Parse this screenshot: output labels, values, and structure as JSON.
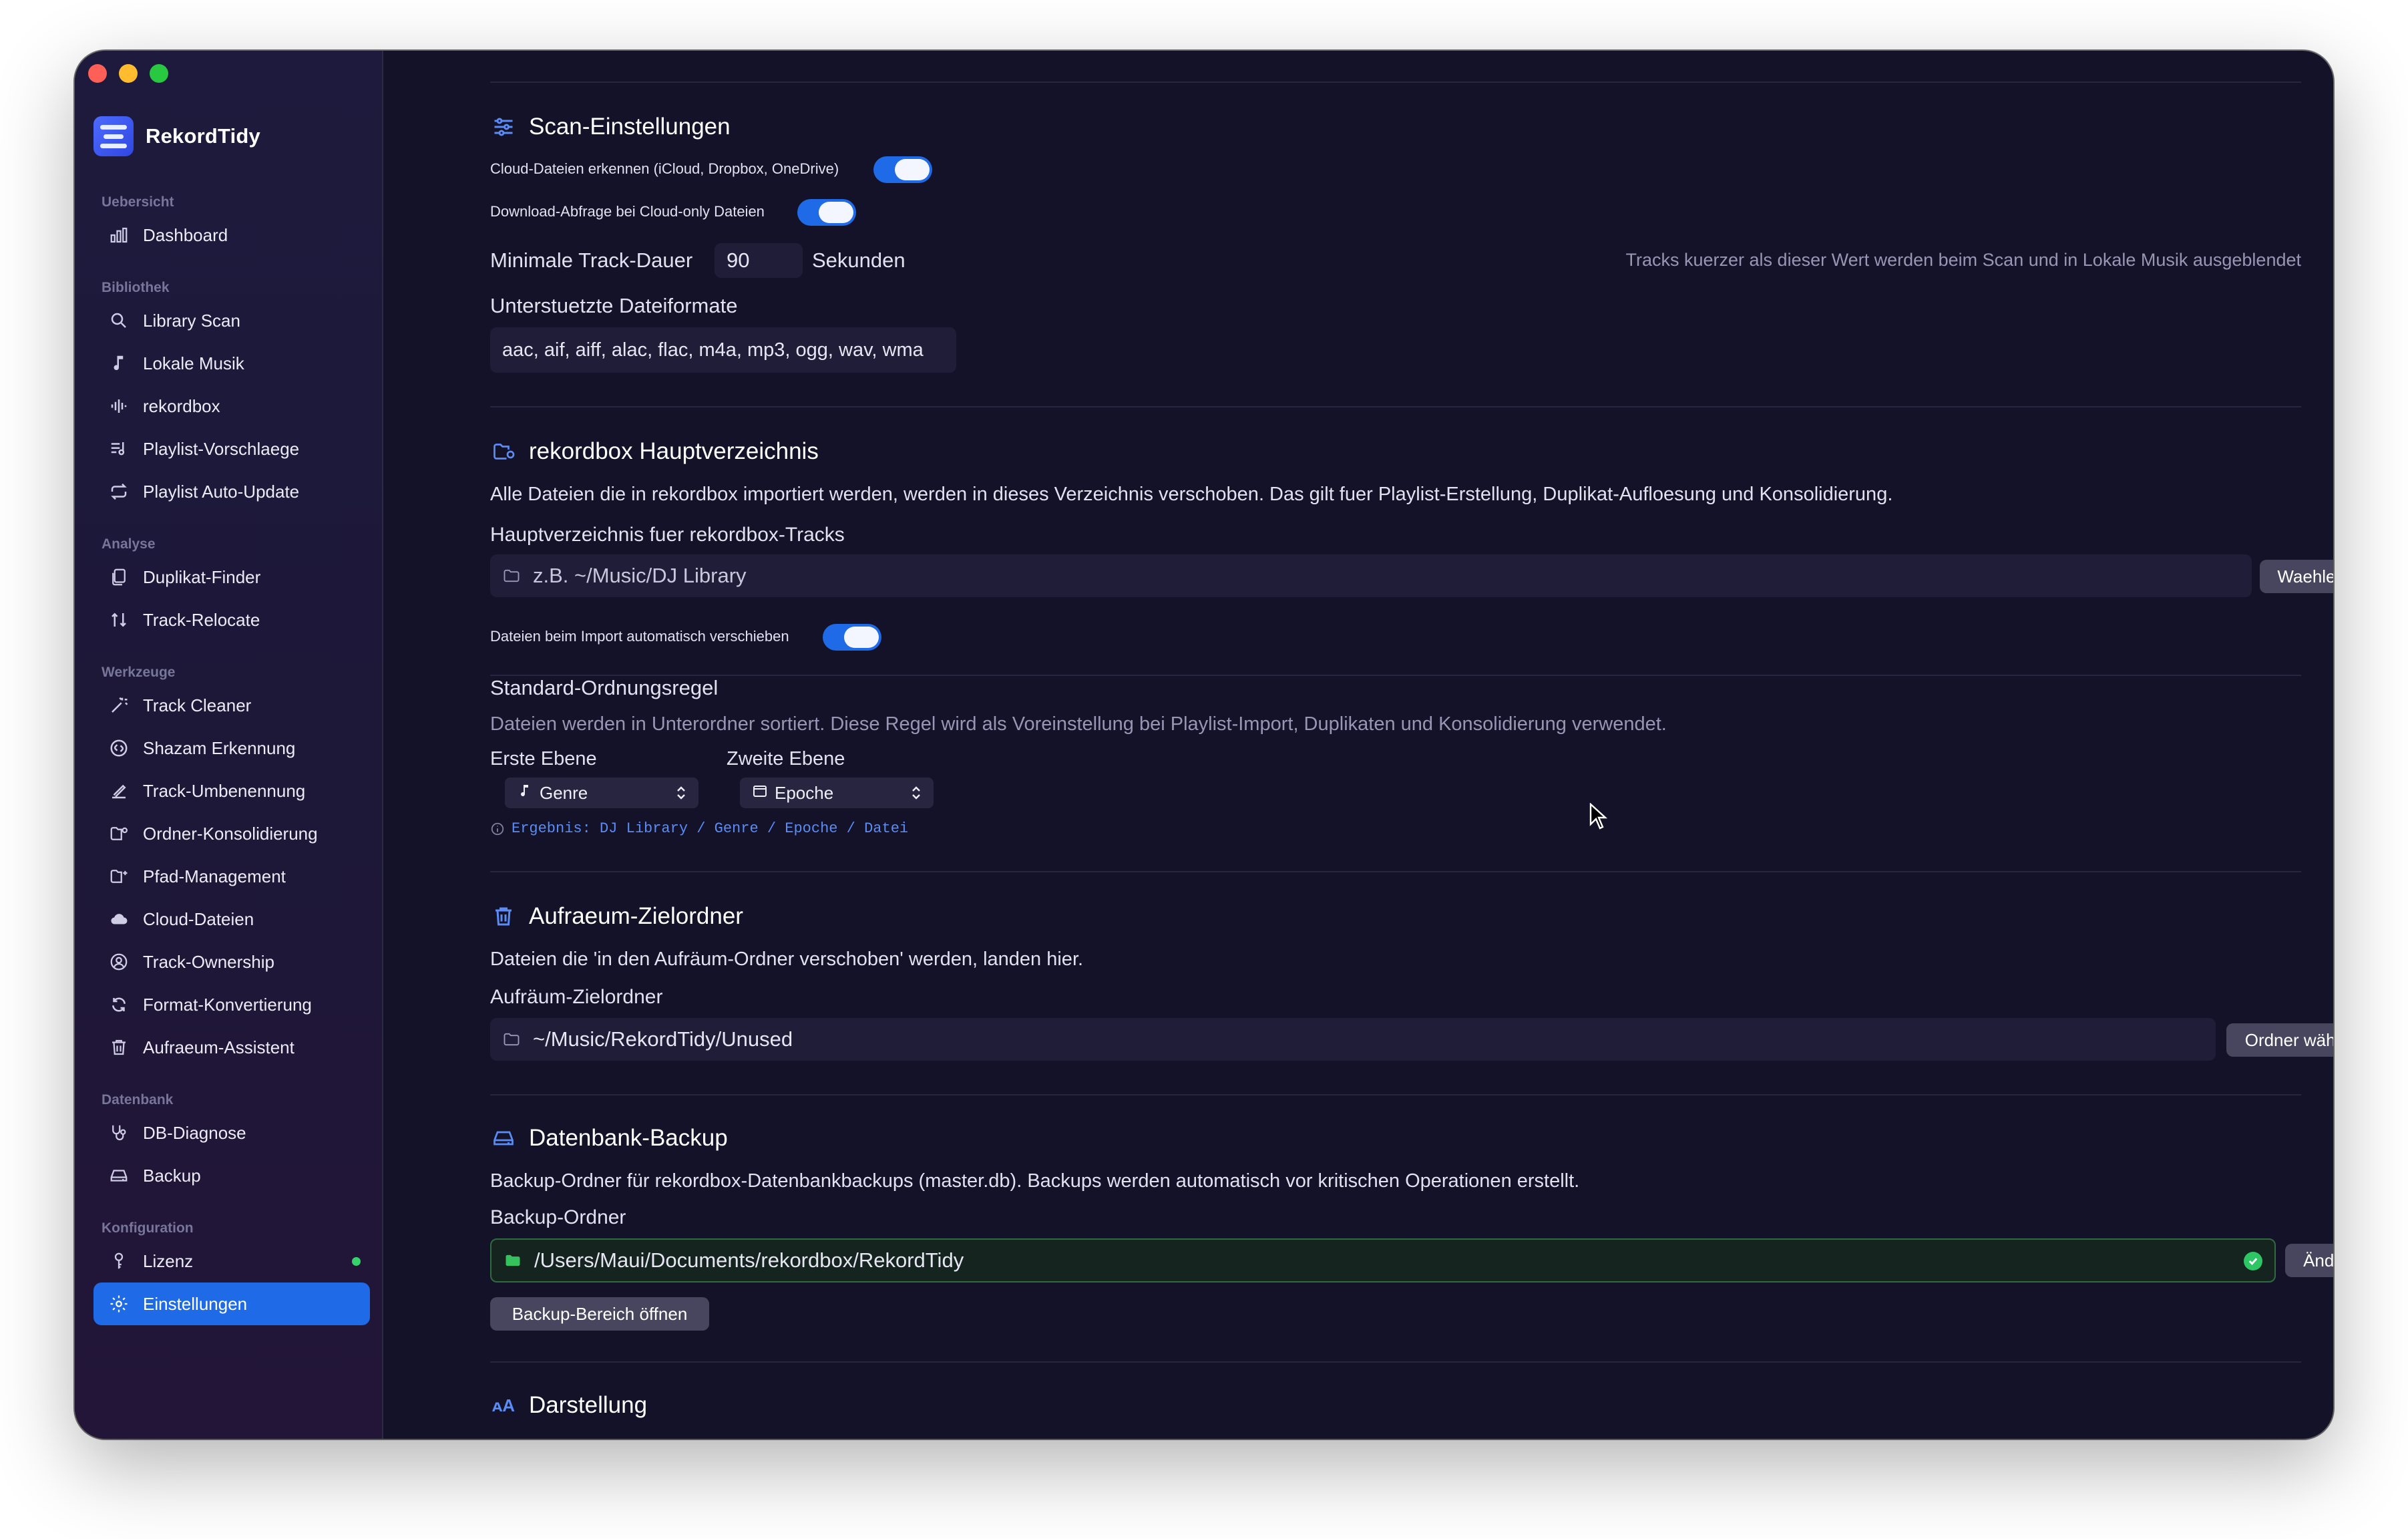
{
  "app": {
    "name": "RekordTidy"
  },
  "sidebar": {
    "sections": [
      {
        "heading": "Uebersicht",
        "items": [
          {
            "label": "Dashboard",
            "icon": "chart-icon"
          }
        ]
      },
      {
        "heading": "Bibliothek",
        "items": [
          {
            "label": "Library Scan",
            "icon": "search-icon"
          },
          {
            "label": "Lokale Musik",
            "icon": "music-note-icon"
          },
          {
            "label": "rekordbox",
            "icon": "waveform-icon"
          },
          {
            "label": "Playlist-Vorschlaege",
            "icon": "playlist-icon"
          },
          {
            "label": "Playlist Auto-Update",
            "icon": "repeat-icon"
          }
        ]
      },
      {
        "heading": "Analyse",
        "items": [
          {
            "label": "Duplikat-Finder",
            "icon": "duplicate-icon"
          },
          {
            "label": "Track-Relocate",
            "icon": "relocate-icon"
          }
        ]
      },
      {
        "heading": "Werkzeuge",
        "items": [
          {
            "label": "Track Cleaner",
            "icon": "wand-icon"
          },
          {
            "label": "Shazam Erkennung",
            "icon": "shazam-icon"
          },
          {
            "label": "Track-Umbenennung",
            "icon": "rename-icon"
          },
          {
            "label": "Ordner-Konsolidierung",
            "icon": "folder-merge-icon"
          },
          {
            "label": "Pfad-Management",
            "icon": "folder-path-icon"
          },
          {
            "label": "Cloud-Dateien",
            "icon": "cloud-icon"
          },
          {
            "label": "Track-Ownership",
            "icon": "ownership-icon"
          },
          {
            "label": "Format-Konvertierung",
            "icon": "convert-icon"
          },
          {
            "label": "Aufraeum-Assistent",
            "icon": "trash-icon"
          }
        ]
      },
      {
        "heading": "Datenbank",
        "items": [
          {
            "label": "DB-Diagnose",
            "icon": "stethoscope-icon"
          },
          {
            "label": "Backup",
            "icon": "drive-icon"
          }
        ]
      },
      {
        "heading": "Konfiguration",
        "items": [
          {
            "label": "Lizenz",
            "icon": "key-icon",
            "status": "active"
          },
          {
            "label": "Einstellungen",
            "icon": "gear-icon",
            "active": true
          }
        ]
      }
    ]
  },
  "scan": {
    "title": "Scan-Einstellungen",
    "cloud_detect_label": "Cloud-Dateien erkennen (iCloud, Dropbox, OneDrive)",
    "cloud_detect_on": true,
    "download_prompt_label": "Download-Abfrage bei Cloud-only Dateien",
    "download_prompt_on": true,
    "min_duration_label": "Minimale Track-Dauer",
    "min_duration_value": "90",
    "min_duration_unit": "Sekunden",
    "min_duration_hint": "Tracks kuerzer als dieser Wert werden beim Scan und in Lokale Musik ausgeblendet",
    "formats_label": "Unterstuetzte Dateiformate",
    "formats_value": "aac, aif, aiff, alac, flac, m4a, mp3, ogg, wav, wma"
  },
  "root": {
    "title": "rekordbox Hauptverzeichnis",
    "description": "Alle Dateien die in rekordbox importiert werden, werden in dieses Verzeichnis verschoben. Das gilt fuer Playlist-Erstellung, Duplikat-Aufloesung und Konsolidierung.",
    "path_label": "Hauptverzeichnis fuer rekordbox-Tracks",
    "path_placeholder": "z.B. ~/Music/DJ Library",
    "choose_button": "Waehlen...",
    "auto_move_label": "Dateien beim Import automatisch verschieben",
    "auto_move_on": true,
    "rule_title": "Standard-Ordnungsregel",
    "rule_description": "Dateien werden in Unterordner sortiert. Diese Regel wird als Voreinstellung bei Playlist-Import, Duplikaten und Konsolidierung verwendet.",
    "first_level_label": "Erste Ebene",
    "first_level_value": "Genre",
    "second_level_label": "Zweite Ebene",
    "second_level_value": "Epoche",
    "result_text": "Ergebnis: DJ Library / Genre / Epoche / Datei"
  },
  "cleanup": {
    "title": "Aufraeum-Zielordner",
    "description": "Dateien die 'in den Aufräum-Ordner verschoben' werden, landen hier.",
    "path_label": "Aufräum-Zielordner",
    "path_value": "~/Music/RekordTidy/Unused",
    "choose_button": "Ordner wählen"
  },
  "backup": {
    "title": "Datenbank-Backup",
    "description": "Backup-Ordner für rekordbox-Datenbankbackups (master.db). Backups werden automatisch vor kritischen Operationen erstellt.",
    "path_label": "Backup-Ordner",
    "path_value": "/Users/Maui/Documents/rekordbox/RekordTidy",
    "change_button": "Ändern",
    "open_button": "Backup-Bereich öffnen"
  },
  "display": {
    "title": "Darstellung"
  },
  "colors": {
    "accent": "#1f6ae6",
    "background": "#131228",
    "success": "#2ec565"
  }
}
